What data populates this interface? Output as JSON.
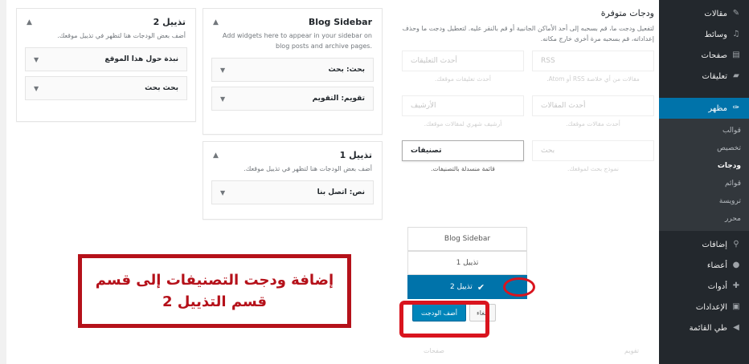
{
  "admin_menu": {
    "items_top": [
      {
        "label": "مقالات",
        "icon": "pin-icon"
      },
      {
        "label": "وسائط",
        "icon": "media-icon"
      },
      {
        "label": "صفحات",
        "icon": "pages-icon"
      },
      {
        "label": "تعليقات",
        "icon": "comments-icon"
      }
    ],
    "current": {
      "label": "مظهر",
      "icon": "appearance-icon"
    },
    "submenu": [
      "قوالب",
      "تخصيص",
      "ودجات",
      "قوائم",
      "ترويسة",
      "محرر"
    ],
    "submenu_active_index": 2,
    "items_bottom": [
      {
        "label": "إضافات",
        "icon": "plugins-icon"
      },
      {
        "label": "أعضاء",
        "icon": "users-icon"
      },
      {
        "label": "أدوات",
        "icon": "tools-icon"
      },
      {
        "label": "الإعدادات",
        "icon": "settings-icon"
      },
      {
        "label": "طي القائمة",
        "icon": "collapse-icon"
      }
    ]
  },
  "footer2_area": {
    "title": "تذييل 2",
    "description": "أضف بعض الودجات هنا لتظهر في تذييل موقعك.",
    "widgets": [
      "نبذة حول هذا الموقع",
      "بحث بحث"
    ]
  },
  "blog_sidebar_area": {
    "title": "Blog Sidebar",
    "description": "Add widgets here to appear in your sidebar on blog posts and archive pages.",
    "widgets": [
      "بحث: بحث",
      "تقويم: التقويم"
    ]
  },
  "footer1_area": {
    "title": "تذييل 1",
    "description": "أضف بعض الودجات هنا لتظهر في تذييل موقعك.",
    "widgets": [
      "نص: اتصل بنا"
    ]
  },
  "available_widgets": {
    "title": "ودجات متوفرة",
    "description": "لتفعيل ودجت ما، قم بسحبه إلى أحد الأماكن الجانبية أو قم بالنقر عليه. لتعطيل ودجت ما وحذف إعداداته، قم بسحبه مرة أخرى خارج مكانه.",
    "rows": [
      {
        "right": {
          "name": "RSS",
          "desc": "مقالات من أي خلاصة RSS أو Atom."
        },
        "left": {
          "name": "أحدث التعليقات",
          "desc": "أحدث تعليقات موقعك."
        }
      },
      {
        "right": {
          "name": "أحدث المقالات",
          "desc": "أحدث مقالات موقعك."
        },
        "left": {
          "name": "الأرشيف",
          "desc": "أرشيف شهري لمقالات موقعك."
        }
      },
      {
        "right": {
          "name": "بحث",
          "desc": "نموذج بحث لموقعك."
        },
        "left": {
          "name": "تصنيفات",
          "desc": "قائمة منسدلة بالتصنيفات."
        }
      }
    ],
    "selected": "تصنيفات"
  },
  "chooser": {
    "options": [
      "Blog Sidebar",
      "تذييل 1",
      "تذييل 2"
    ],
    "selected_index": 2,
    "add_button": "أضف الودجت",
    "cancel_button": "إلغاء"
  },
  "bottom_row": {
    "right": "تقويم",
    "left": "صفحات"
  },
  "annotation": {
    "line1": "إضافة ودجت التصنيفات إلى قسم",
    "line2": "قسم التذييل 2"
  },
  "colors": {
    "admin_bg": "#23282d",
    "accent_blue": "#0073aa",
    "highlight_red": "#d9141e"
  }
}
